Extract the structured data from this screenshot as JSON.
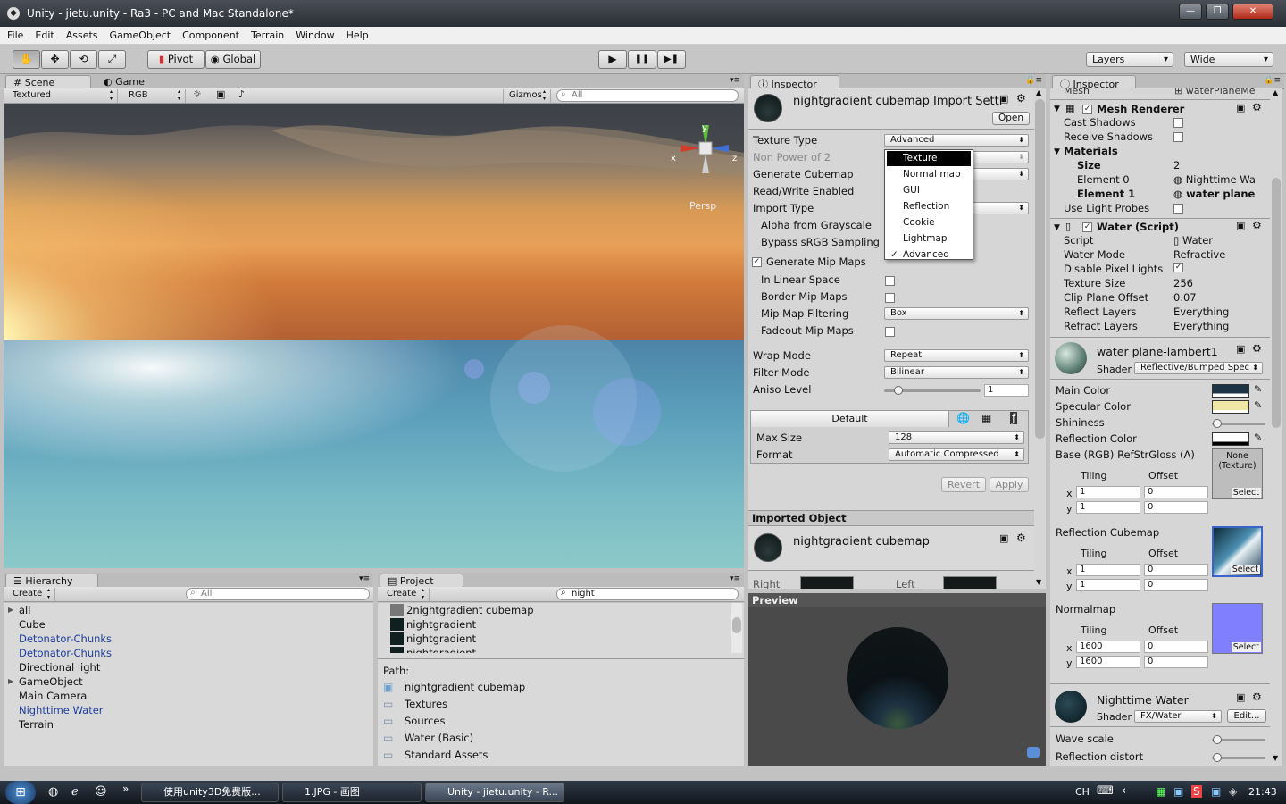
{
  "window": {
    "title": "Unity - jietu.unity - Ra3 - PC and Mac Standalone*",
    "min": "—",
    "max": "❐",
    "close": "✕"
  },
  "menu": [
    "File",
    "Edit",
    "Assets",
    "GameObject",
    "Component",
    "Terrain",
    "Window",
    "Help"
  ],
  "toolbar": {
    "pivot": "Pivot",
    "global": "Global",
    "layers": "Layers",
    "layout": "Wide",
    "play": "▶",
    "pause": "❚❚",
    "step": "▶❚"
  },
  "scene": {
    "tab_scene": "Scene",
    "tab_game": "Game",
    "render_mode": "Textured",
    "color_mode": "RGB",
    "gizmos": "Gizmos",
    "search": "All",
    "persp": "Persp",
    "axis_x": "x",
    "axis_y": "y",
    "axis_z": "z"
  },
  "hierarchy": {
    "title": "Hierarchy",
    "create": "Create",
    "search": "All",
    "items": [
      {
        "label": "all",
        "fold": true,
        "blue": false
      },
      {
        "label": "Cube",
        "fold": false,
        "blue": false
      },
      {
        "label": "Detonator-Chunks",
        "fold": false,
        "blue": true
      },
      {
        "label": "Detonator-Chunks",
        "fold": false,
        "blue": true
      },
      {
        "label": "Directional light",
        "fold": false,
        "blue": false
      },
      {
        "label": "GameObject",
        "fold": true,
        "blue": false
      },
      {
        "label": "Main Camera",
        "fold": false,
        "blue": false
      },
      {
        "label": "Nighttime Water",
        "fold": false,
        "blue": true
      },
      {
        "label": "Terrain",
        "fold": false,
        "blue": false
      }
    ]
  },
  "project": {
    "title": "Project",
    "create": "Create",
    "search": "night",
    "items": [
      "2nightgradient cubemap",
      "nightgradient",
      "nightgradient",
      "nightgradient"
    ],
    "path_label": "Path:",
    "path": [
      "nightgradient cubemap",
      "Textures",
      "Sources",
      "Water (Basic)",
      "Standard Assets"
    ]
  },
  "inspector1": {
    "title": "Inspector",
    "asset": "nightgradient cubemap Import Setti",
    "open": "Open",
    "texture_type_label": "Texture Type",
    "texture_type": "Advanced",
    "npot": "Non Power of 2",
    "gen_cubemap": "Generate Cubemap",
    "rw": "Read/Write Enabled",
    "import_type": "Import Type",
    "alpha": "Alpha from Grayscale",
    "bypass": "Bypass sRGB Sampling",
    "gen_mip": "Generate Mip Maps",
    "linear": "In Linear Space",
    "border": "Border Mip Maps",
    "mip_filter_label": "Mip Map Filtering",
    "mip_filter": "Box",
    "fadeout": "Fadeout Mip Maps",
    "wrap_label": "Wrap Mode",
    "wrap": "Repeat",
    "filter_label": "Filter Mode",
    "filter": "Bilinear",
    "aniso_label": "Aniso Level",
    "aniso": "1",
    "aniso_level": 1,
    "platform": "Default",
    "max_size_label": "Max Size",
    "max_size": "128",
    "format_label": "Format",
    "format": "Automatic Compressed",
    "revert": "Revert",
    "apply": "Apply",
    "imported": "Imported Object",
    "imported_name": "nightgradient cubemap",
    "right": "Right",
    "left": "Left",
    "preview": "Preview",
    "dropdown": [
      "Texture",
      "Normal map",
      "GUI",
      "Reflection",
      "Cookie",
      "Lightmap",
      "Advanced"
    ],
    "dropdown_checked": "Advanced",
    "dropdown_hover": "Texture"
  },
  "inspector2": {
    "title": "Inspector",
    "mesh_label": "Mesh",
    "mesh_value": "waterPlaneMe",
    "mesh_renderer": "Mesh Renderer",
    "cast": "Cast Shadows",
    "receive": "Receive Shadows",
    "materials": "Materials",
    "size_label": "Size",
    "size": "2",
    "el0_label": "Element 0",
    "el0": "Nighttime Wa",
    "el1_label": "Element 1",
    "el1": "water plane",
    "probes": "Use Light Probes",
    "water_script": "Water (Script)",
    "script_label": "Script",
    "script": "Water",
    "mode_label": "Water Mode",
    "mode": "Refractive",
    "disable_label": "Disable Pixel Lights",
    "texsize_label": "Texture Size",
    "texsize": "256",
    "clip_label": "Clip Plane Offset",
    "clip": "0.07",
    "reflect_label": "Reflect Layers",
    "reflect": "Everything",
    "refract_label": "Refract Layers",
    "refract": "Everything",
    "mat1": "water plane-lambert1",
    "shader_label": "Shader",
    "shader1": "Reflective/Bumped Spec",
    "main_color": "Main Color",
    "spec_color": "Specular Color",
    "shininess": "Shininess",
    "shininess_level": 0.02,
    "refl_color": "Reflection Color",
    "base": "Base (RGB) RefStrGloss (A)",
    "none_tex": "None (Texture)",
    "select": "Select",
    "tiling": "Tiling",
    "offset": "Offset",
    "x": "x",
    "y": "y",
    "base_tiling": [
      "1",
      "1"
    ],
    "base_offset": [
      "0",
      "0"
    ],
    "refl_cube": "Reflection Cubemap",
    "cube_tiling": [
      "1",
      "1"
    ],
    "cube_offset": [
      "0",
      "0"
    ],
    "normalmap": "Normalmap",
    "nm_tiling": [
      "1600",
      "1600"
    ],
    "nm_offset": [
      "0",
      "0"
    ],
    "mat2": "Nighttime Water",
    "shader2": "FX/Water",
    "edit": "Edit...",
    "wave": "Wave scale",
    "wave_level": 0.02,
    "refl_distort": "Reflection distort",
    "refl_distort_level": 0.02,
    "colors": {
      "main": "#1d3447",
      "spec": "#f0e6a6",
      "refl": "#ffffff",
      "normal": "#8080ff"
    }
  },
  "taskbar": {
    "t1": "使用unity3D免费版...",
    "t2": "1.JPG - 画图",
    "t3": "Unity - jietu.unity - R...",
    "lang": "CH",
    "time": "21:43"
  }
}
